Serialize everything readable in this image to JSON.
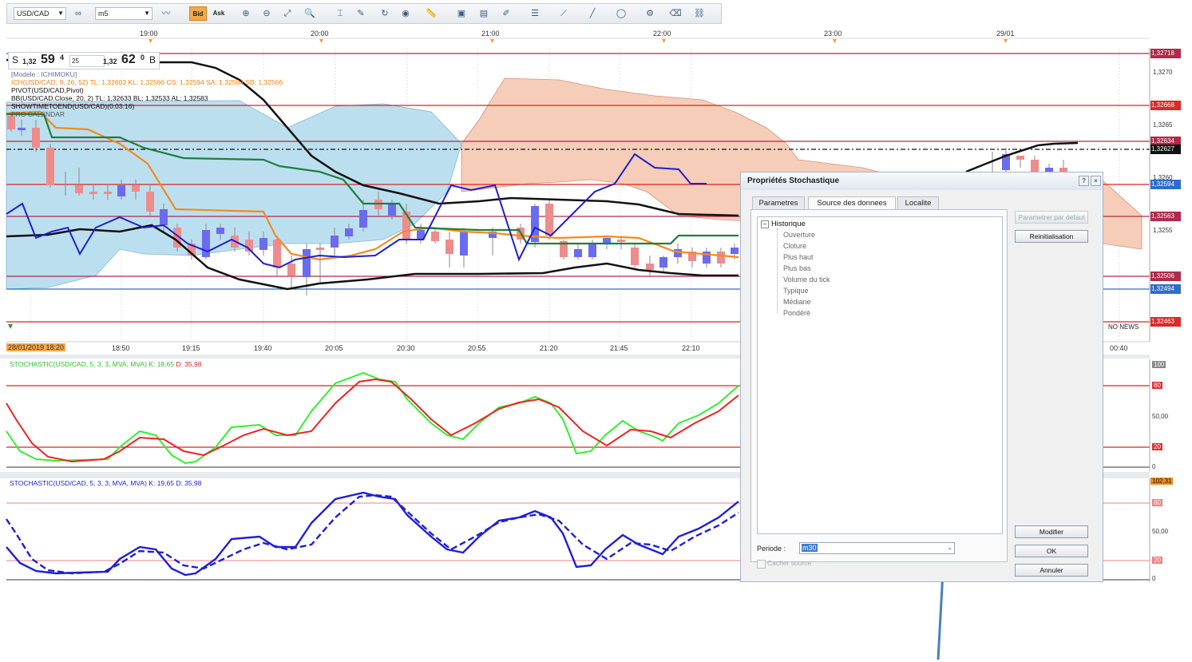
{
  "toolbar": {
    "symbol": "USD/CAD",
    "period": "m5",
    "bid_label": "Bid",
    "ask_label": "Ask"
  },
  "time_axis_top": [
    "19:00",
    "20:00",
    "21:00",
    "22:00",
    "23:00",
    "29/01"
  ],
  "time_axis_bottom": [
    "28/01/2019 18:20",
    "18:50",
    "19:15",
    "19:40",
    "20:05",
    "20:30",
    "20:55",
    "21:20",
    "21:45",
    "22:10",
    "00:40"
  ],
  "quote": {
    "sell_label": "S",
    "sell_prefix": "1,32",
    "sell_big": "59",
    "sell_sup": "4",
    "spread": "25",
    "buy_prefix": "1,32",
    "buy_big": "62",
    "buy_sup": "0",
    "buy_label": "B"
  },
  "legend": {
    "model": "[Modele : ICHIMOKU]",
    "ich": "ICH(USD/CAD, 9, 26, 52)  TL: 1,32603  KL: 1,32566  CS: 1,32594  SA: 1,32584  SB: 1,32566",
    "pivot": "PIVOT(USD/CAD,Pivot)",
    "bb": "BB(USD/CAD.Close, 20, 2)  TL: 1,32633  BL: 1,32533  AL: 1,32583",
    "showtime": "SHOWTIMETOEND(USD/CAD)(0:03:16)",
    "pro": "PRO CALENDAR"
  },
  "price_axis": [
    "1,3270",
    "1,3265",
    "1,3260",
    "1,3255"
  ],
  "price_tags": [
    {
      "value": "1,32718",
      "color": "#b02a4a"
    },
    {
      "value": "1,32668",
      "color": "#d92b2b"
    },
    {
      "value": "1,32634",
      "color": "#b02a4a"
    },
    {
      "value": "1,32627",
      "color": "#111111"
    },
    {
      "value": "1,32594",
      "color": "#2f6ccb"
    },
    {
      "value": "1,32563",
      "color": "#b02a4a"
    },
    {
      "value": "1,32506",
      "color": "#b02a4a"
    },
    {
      "value": "1,32494",
      "color": "#2f6ccb"
    },
    {
      "value": "1,32463",
      "color": "#d92b2b"
    }
  ],
  "no_news": "NO NEWS",
  "stoch1": {
    "legend_name": "STOCHASTIC(USD/CAD, 5, 3, 3, MVA, MVA)",
    "k": "K: 19,65",
    "d": "D: 35,98",
    "axis": [
      "100",
      "80",
      "50,00",
      "20",
      "0"
    ]
  },
  "stoch2": {
    "legend_name": "STOCHASTIC(USD/CAD, 5, 3, 3, MVA, MVA)",
    "k": "K: 19,65",
    "d": "D: 35,98",
    "tag": "102,31",
    "axis": [
      "80",
      "50,00",
      "20",
      "0"
    ]
  },
  "dialog": {
    "title": "Propriétés Stochastique",
    "help": "?",
    "close": "×",
    "tabs": [
      "Parametres",
      "Source des donnees",
      "Localite"
    ],
    "active_tab": "Source des donnees",
    "tree_root": "Historique",
    "tree_items": [
      "Ouverture",
      "Cloture",
      "Plus haut",
      "Plus bas",
      "Volume du tick",
      "Typique",
      "Médiane",
      "Pondéré"
    ],
    "btn_default": "Parametrer par defaut",
    "btn_reset": "Reinitialisation",
    "btn_modify": "Modifier",
    "btn_ok": "OK",
    "btn_cancel": "Annuler",
    "periode_label": "Periode :",
    "periode_value": "m30",
    "hide_source": "Cacher source"
  },
  "colors": {
    "ichimoku_cloud_bull": "#bcdff0",
    "ichimoku_cloud_bear": "#f5cdb8",
    "candle_up": "#6b6bf0",
    "candle_down": "#ee8c8c",
    "arrow": "#4a7fc1"
  }
}
